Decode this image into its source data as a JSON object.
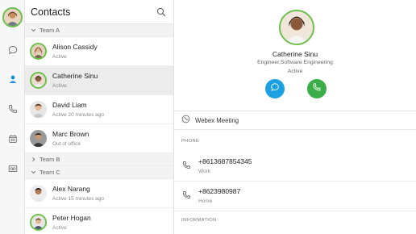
{
  "app": {
    "accent_online": "#6cc04a",
    "accent_message": "#1ba1e2",
    "accent_call": "#3aad49"
  },
  "rail": {
    "items": [
      {
        "icon": "chat-icon"
      },
      {
        "icon": "contacts-icon"
      },
      {
        "icon": "phone-icon"
      },
      {
        "icon": "calendar-icon"
      },
      {
        "icon": "voicemail-icon"
      }
    ]
  },
  "list": {
    "title": "Contacts",
    "groups": [
      {
        "label": "Team A",
        "expanded": true
      },
      {
        "label": "Team B",
        "expanded": false
      },
      {
        "label": "Team C",
        "expanded": true
      }
    ],
    "contacts": [
      {
        "name": "Alison Cassidy",
        "status": "Active",
        "group": "Team A"
      },
      {
        "name": "Catherine Sinu",
        "status": "Active",
        "group": "Team A",
        "selected": true
      },
      {
        "name": "David Liam",
        "status": "Active 20 minutes ago",
        "group": "Team A"
      },
      {
        "name": "Marc Brown",
        "status": "Out of office",
        "group": "Team A"
      },
      {
        "name": "Alex Narang",
        "status": "Active 15 minutes ago",
        "group": "Team C"
      },
      {
        "name": "Peter Hogan",
        "status": "Active",
        "group": "Team C"
      }
    ]
  },
  "detail": {
    "name": "Catherine Sinu",
    "title": "Engineer,Software Engineering",
    "status": "Active",
    "webex_label": "Webex Meeting",
    "phone_header": "PHONE",
    "phones": [
      {
        "number": "+8613687854345",
        "label": "Work"
      },
      {
        "number": "+8623980987",
        "label": "Home"
      }
    ],
    "info_header": "INFORMATION"
  }
}
